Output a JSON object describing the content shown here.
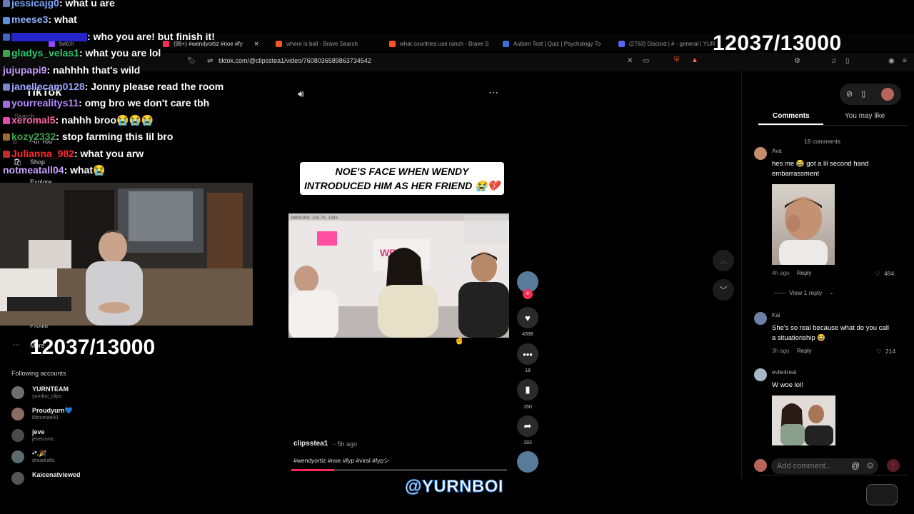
{
  "browser": {
    "tabs": [
      {
        "label": "twitch",
        "color": "#9146ff"
      },
      {
        "label": "(99+) #wendyortiz #noe #fy",
        "color": "#ff2d55"
      },
      {
        "label": "where is ball - Brave Search",
        "color": "#fb542b"
      },
      {
        "label": "what countries use ranch - Brave S",
        "color": "#fb542b"
      },
      {
        "label": "Autism Test | Quiz | Psychology To",
        "color": "#3b6fd8"
      },
      {
        "label": "(2763) Discord | # - general | YUR",
        "color": "#5865f2"
      }
    ],
    "url": "tiktok.com/@clipsstea1/video/7608036589863734542"
  },
  "counter": {
    "top_right": "12037/13000",
    "left": "12037/13000"
  },
  "chat": [
    {
      "user": "jessicajg0",
      "msg": ": what u are",
      "color": "#7aa8ff"
    },
    {
      "user": "meese3",
      "msg": ": what",
      "color": "#8fb0ff"
    },
    {
      "user": "",
      "msg": ": who you are! but finish it!",
      "color": "#3333dd"
    },
    {
      "user": "gladys_velas1",
      "msg": ": what you are lol",
      "color": "#2ecc71"
    },
    {
      "user": "jujupapi9",
      "msg": ": nahhhh that's wild",
      "color": "#c49bff"
    },
    {
      "user": "janellecam0128",
      "msg": ": Jonny please read the room",
      "color": "#9aa6ff"
    },
    {
      "user": "yourrealitys11",
      "msg": ": omg bro we don't care tbh",
      "color": "#b58cff"
    },
    {
      "user": "xeromal5",
      "msg": ": nahhh broo😭😭😭",
      "color": "#ff66aa"
    },
    {
      "user": "kozy2332",
      "msg": ": stop farming this lil bro",
      "color": "#3fa34d"
    },
    {
      "user": "Julianna_982",
      "msg": ": what you arw",
      "color": "#ff2b2b"
    },
    {
      "user": "notmeatall04",
      "msg": ": what😭",
      "color": "#c8a2ff"
    }
  ],
  "sidebar": {
    "logo": "TikTok",
    "search": "Search",
    "items": [
      "For You",
      "Shop",
      "Explore",
      "Profile",
      "More"
    ],
    "following_title": "Following accounts",
    "following": [
      {
        "name": "YURNTEAM",
        "handle": "yurnboi_clips"
      },
      {
        "name": "Proudyurn💙",
        "handle": "lilbromari00"
      },
      {
        "name": "jeve",
        "handle": "jeveiconic"
      },
      {
        "name": "▪︎*.🎉",
        "handle": "dreadrafts"
      },
      {
        "name": "Kaicenatviewed",
        "handle": ""
      }
    ]
  },
  "video": {
    "caption": "NOE'S FACE WHEN WENDY INTRODUCED HIM AS HER FRIEND 😭💔",
    "overlay_tag": "MINIONS: 159.7K, 1093",
    "author": "clipsstea1",
    "time": "· 5h ago",
    "hashtags": "#wendyortiz #noe #fyp #viral #fypシ",
    "likes": "4398",
    "comments": "18",
    "saves": "150",
    "shares": "193",
    "progress": 0.2
  },
  "comments_panel": {
    "tabs": [
      "Comments",
      "You may like"
    ],
    "count": "18 comments",
    "items": [
      {
        "user": "Ava",
        "text": "hes me 😂 got a lil second hand embarrassment",
        "time": "4h ago",
        "reply": "Reply",
        "likes": "484",
        "view_replies": "View 1 reply"
      },
      {
        "user": "Kai",
        "text": "She's so real because what do you call a situationship 😂",
        "time": "3h ago",
        "reply": "Reply",
        "likes": "214"
      },
      {
        "user": "evlie4real",
        "text": "W woe lol!"
      }
    ],
    "add_placeholder": "Add comment..."
  },
  "watermark": "@YURNBOI"
}
